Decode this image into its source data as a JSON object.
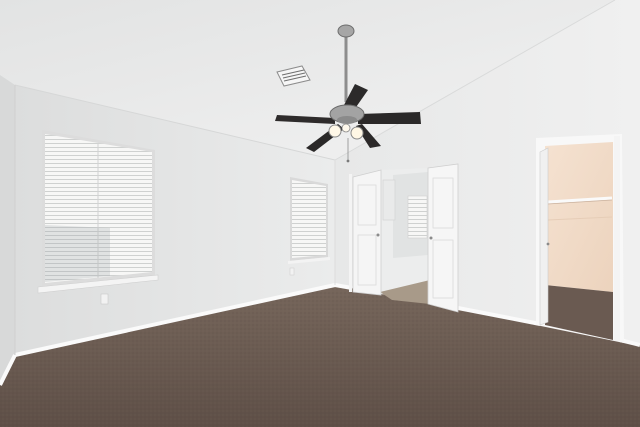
{
  "scene": {
    "kind": "photo",
    "subject": "empty-bedroom",
    "features": [
      "ceiling-fan",
      "window-with-blinks-left",
      "window-with-blinds-center",
      "double-doors-bath",
      "closet-door-open",
      "carpet-floor"
    ]
  },
  "colors": {
    "ceiling": "#ececeb",
    "wall_left": "#e8e9e9",
    "wall_back": "#e6e7e7",
    "wall_right": "#eeeeee",
    "carpet": "#6b5b52",
    "carpet_dark": "#5a4b43",
    "baseboard": "#f7f7f7",
    "fan_blade": "#2d2b2b",
    "fan_metal": "#9a9a9a",
    "closet_wall": "#f2dcc8",
    "door": "#f4f4f4",
    "blind": "#f5f5f4"
  }
}
